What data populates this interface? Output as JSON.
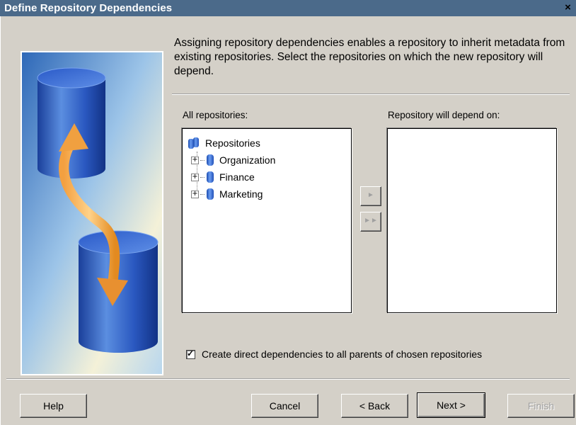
{
  "window": {
    "title": "Define Repository Dependencies",
    "close_glyph": "×"
  },
  "description": "Assigning repository dependencies enables a repository to inherit metadata from existing repositories. Select the repositories on which the new repository will depend.",
  "left_list": {
    "label": "All repositories:",
    "root": {
      "label": "Repositories",
      "icon": "repositories-icon"
    },
    "items": [
      {
        "label": "Organization",
        "icon": "repository-icon",
        "expander": "+"
      },
      {
        "label": "Finance",
        "icon": "repository-icon",
        "expander": "+"
      },
      {
        "label": "Marketing",
        "icon": "repository-icon",
        "expander": "+"
      }
    ]
  },
  "right_list": {
    "label": "Repository will depend on:",
    "items": []
  },
  "move_buttons": {
    "add_one": "►",
    "add_all": "►►"
  },
  "checkbox": {
    "label": "Create direct dependencies to all parents of chosen repositories",
    "checked": true,
    "check_glyph": "✓"
  },
  "buttons": {
    "help": "Help",
    "cancel": "Cancel",
    "back": "< Back",
    "next": "Next >",
    "finish": "Finish"
  }
}
